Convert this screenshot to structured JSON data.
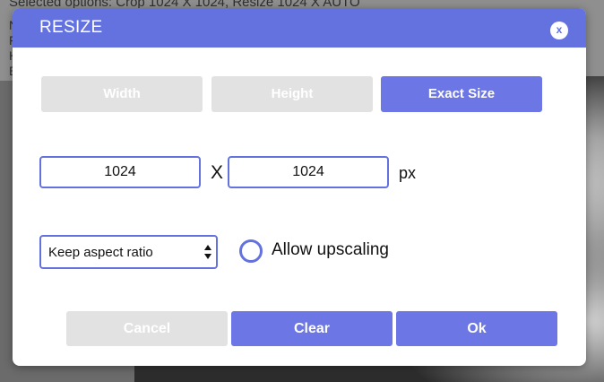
{
  "background": {
    "options_text": "Selected options: Crop 1024 X 1024, Resize 1024 X AUTO",
    "side_letters": [
      "N",
      "F",
      "H",
      "E"
    ]
  },
  "dialog": {
    "title": "RESIZE",
    "close_label": "x",
    "tabs": [
      {
        "label": "Width",
        "active": false
      },
      {
        "label": "Height",
        "active": false
      },
      {
        "label": "Exact Size",
        "active": true
      }
    ],
    "width_value": "1024",
    "height_value": "1024",
    "separator": "X",
    "unit": "px",
    "aspect_select": {
      "selected": "Keep aspect ratio"
    },
    "upscaling": {
      "label": "Allow upscaling",
      "checked": false
    },
    "buttons": {
      "cancel": "Cancel",
      "clear": "Clear",
      "ok": "Ok"
    }
  },
  "colors": {
    "accent": "#6472e0",
    "inactive": "#e2e2e2"
  }
}
